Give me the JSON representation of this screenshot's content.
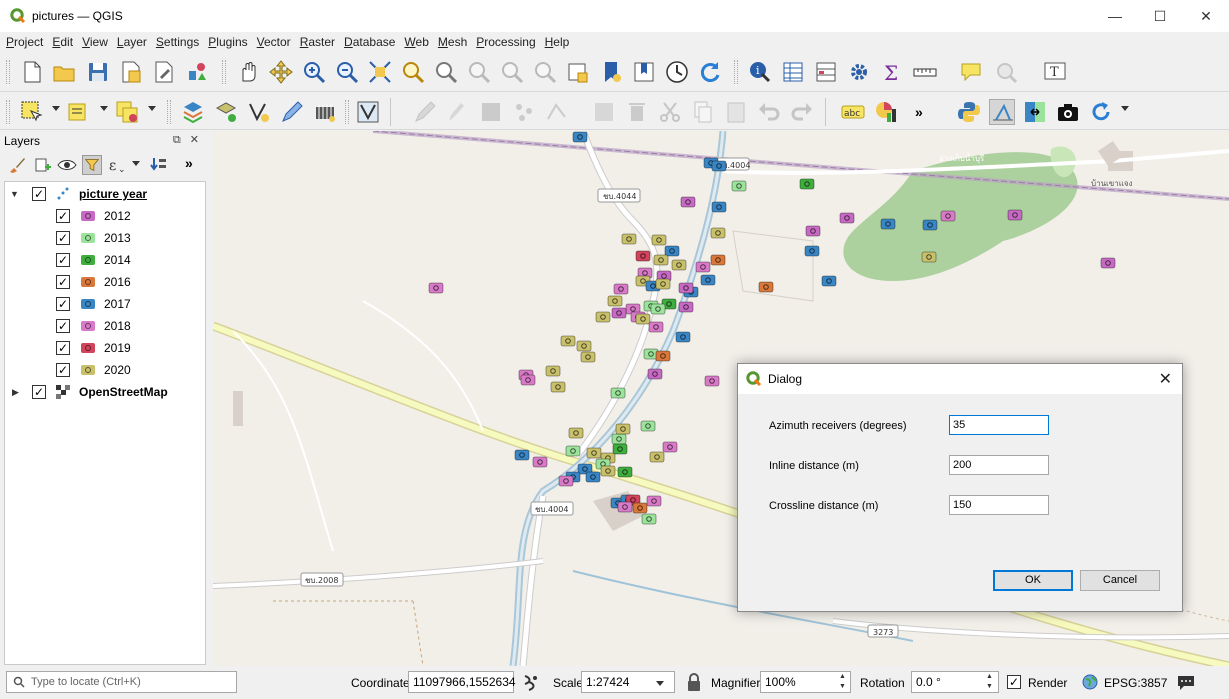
{
  "window": {
    "title": "pictures — QGIS",
    "minimize": "—",
    "maximize": "☐",
    "close": "✕"
  },
  "menu": [
    "Project",
    "Edit",
    "View",
    "Layer",
    "Settings",
    "Plugins",
    "Vector",
    "Raster",
    "Database",
    "Web",
    "Mesh",
    "Processing",
    "Help"
  ],
  "layers_panel": {
    "title": "Layers",
    "header_buttons": "⧉ ✕",
    "tree": [
      {
        "label": "picture year",
        "checked": true,
        "expanded": true,
        "style": "group"
      },
      {
        "label": "2012",
        "checked": true,
        "color": "#c76ac4"
      },
      {
        "label": "2013",
        "checked": true,
        "color": "#9be39b"
      },
      {
        "label": "2014",
        "checked": true,
        "color": "#3fae3f"
      },
      {
        "label": "2016",
        "checked": true,
        "color": "#d9783a"
      },
      {
        "label": "2017",
        "checked": true,
        "color": "#3a86c4"
      },
      {
        "label": "2018",
        "checked": true,
        "color": "#d97ac8"
      },
      {
        "label": "2019",
        "checked": true,
        "color": "#d2445c"
      },
      {
        "label": "2020",
        "checked": true,
        "color": "#c8c06a"
      },
      {
        "label": "OpenStreetMap",
        "checked": true,
        "expanded": false,
        "style": "raster"
      }
    ]
  },
  "map": {
    "road_labels": [
      "ชบ.4044",
      "ชบ.4004",
      "ชบ.4004",
      "ชบ.2008",
      "3273"
    ],
    "place_labels": [
      "บ้านเขาแจง",
      "อ่างเก็บน้ำบุรี"
    ]
  },
  "dialog": {
    "title": "Dialog",
    "fields": [
      {
        "label": "Azimuth receivers (degrees)",
        "value": "35"
      },
      {
        "label": "Inline distance (m)",
        "value": "200"
      },
      {
        "label": "Crossline distance (m)",
        "value": "150"
      }
    ],
    "ok": "OK",
    "cancel": "Cancel"
  },
  "status": {
    "locate_placeholder": "Type to locate (Ctrl+K)",
    "coordinate_label": "Coordinate",
    "coordinate_value": "11097966,1552634",
    "scale_label": "Scale",
    "scale_value": "1:27424",
    "magnifier_label": "Magnifier",
    "magnifier_value": "100%",
    "rotation_label": "Rotation",
    "rotation_value": "0.0 °",
    "render_label": "Render",
    "crs": "EPSG:3857"
  }
}
